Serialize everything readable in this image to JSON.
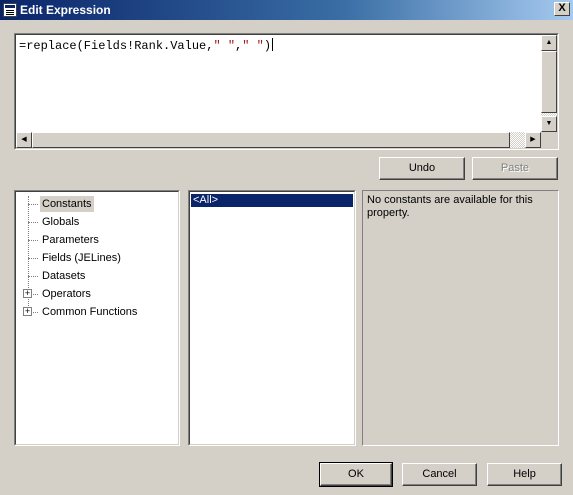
{
  "window": {
    "title": "Edit Expression",
    "close_label": "X"
  },
  "expression": {
    "prefix": "=replace(Fields!Rank.Value,",
    "arg1": "\" \"",
    "comma": ",",
    "arg2": "\" \"",
    "suffix": ")"
  },
  "editor_buttons": {
    "undo": "Undo",
    "paste": "Paste"
  },
  "tree": {
    "items": [
      {
        "label": "Constants",
        "selected": true,
        "expandable": false
      },
      {
        "label": "Globals",
        "expandable": false
      },
      {
        "label": "Parameters",
        "expandable": false
      },
      {
        "label": "Fields (JELines)",
        "expandable": false
      },
      {
        "label": "Datasets",
        "expandable": false
      },
      {
        "label": "Operators",
        "expandable": true
      },
      {
        "label": "Common Functions",
        "expandable": true
      }
    ]
  },
  "list": {
    "items": [
      {
        "label": "<All>",
        "selected": true
      }
    ]
  },
  "description": {
    "text": "No constants are available for this property."
  },
  "dialog_buttons": {
    "ok": "OK",
    "cancel": "Cancel",
    "help": "Help"
  },
  "icons": {
    "app": "expression-dialog-icon",
    "close": "close-icon",
    "scroll_up": "arrow-up-icon",
    "scroll_down": "arrow-down-icon",
    "scroll_left": "arrow-left-icon",
    "scroll_right": "arrow-right-icon",
    "expander": "plus-expander-icon"
  },
  "colors": {
    "title_bar": "#0a246a",
    "selection": "#0a246a",
    "dialog_bg": "#d4d0c8",
    "string_literal": "#a31515"
  }
}
